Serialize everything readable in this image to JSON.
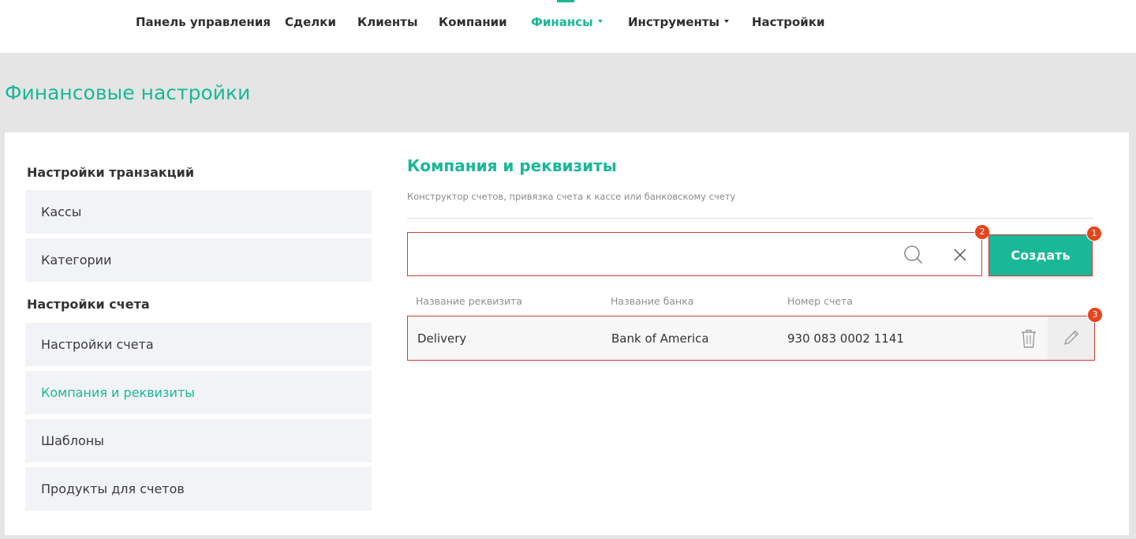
{
  "nav": {
    "items": [
      {
        "label": "Панель управления"
      },
      {
        "label": "Сделки"
      },
      {
        "label": "Клиенты"
      },
      {
        "label": "Компании"
      },
      {
        "label": "Финансы",
        "active": true,
        "dropdown": true
      },
      {
        "label": "Инструменты",
        "dropdown": true
      },
      {
        "label": "Настройки"
      }
    ]
  },
  "page": {
    "title": "Финансовые настройки"
  },
  "sidebar": {
    "sections": [
      {
        "heading": "Настройки транзакций",
        "items": [
          "Кассы",
          "Категории"
        ]
      },
      {
        "heading": "Настройки счета",
        "items": [
          "Настройки счета",
          "Компания и реквизиты",
          "Шаблоны",
          "Продукты для счетов"
        ]
      }
    ],
    "active_item": "Компания и реквизиты"
  },
  "content": {
    "title": "Компания и реквизиты",
    "subtitle": "Конструктор счетов, привязка счета к кассе или банковскому счету",
    "search": {
      "value": "",
      "placeholder": ""
    },
    "create_label": "Создать",
    "columns": [
      "Название реквизита",
      "Название банка",
      "Номер счета"
    ],
    "rows": [
      {
        "name": "Delivery",
        "bank": "Bank of America",
        "account": "930 083 0002 1141"
      }
    ]
  },
  "badges": [
    "1",
    "2",
    "3"
  ],
  "icons": {
    "search": "search-icon",
    "clear": "close-icon",
    "delete": "trash-icon",
    "edit": "pencil-icon"
  },
  "colors": {
    "accent": "#19b897",
    "highlight": "#d13b3b",
    "badge": "#e8431b"
  }
}
